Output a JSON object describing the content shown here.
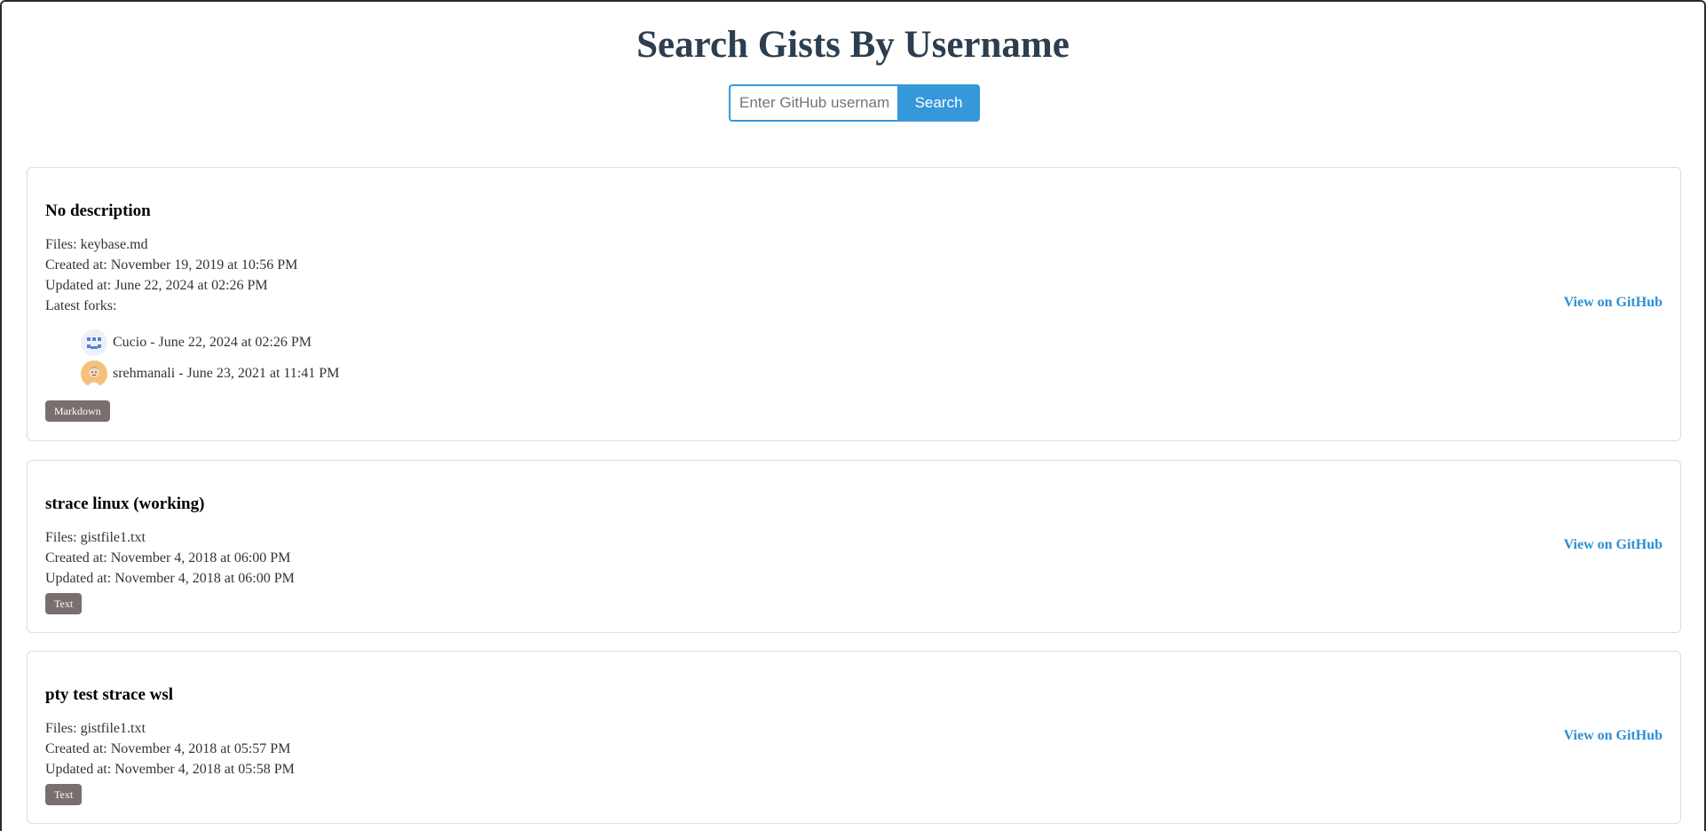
{
  "header": {
    "title": "Search Gists By Username"
  },
  "search": {
    "placeholder": "Enter GitHub username",
    "button_label": "Search"
  },
  "gists": [
    {
      "title": "No description",
      "files": "Files: keybase.md",
      "created": "Created at: November 19, 2019 at 10:56 PM",
      "updated": "Updated at: June 22, 2024 at 02:26 PM",
      "forks_label": "Latest forks:",
      "forks": [
        {
          "text": "Cucio - June 22, 2024 at 02:26 PM"
        },
        {
          "text": "srehmanali - June 23, 2021 at 11:41 PM"
        }
      ],
      "badge": "Markdown",
      "link": "View on GitHub"
    },
    {
      "title": "strace linux (working)",
      "files": "Files: gistfile1.txt",
      "created": "Created at: November 4, 2018 at 06:00 PM",
      "updated": "Updated at: November 4, 2018 at 06:00 PM",
      "badge": "Text",
      "link": "View on GitHub"
    },
    {
      "title": "pty test strace wsl",
      "files": "Files: gistfile1.txt",
      "created": "Created at: November 4, 2018 at 05:57 PM",
      "updated": "Updated at: November 4, 2018 at 05:58 PM",
      "badge": "Text",
      "link": "View on GitHub"
    }
  ],
  "colors": {
    "title": "#2c3e50",
    "accent": "#3498db",
    "link": "#2b8fd6",
    "badge": "#7a6f6f"
  }
}
